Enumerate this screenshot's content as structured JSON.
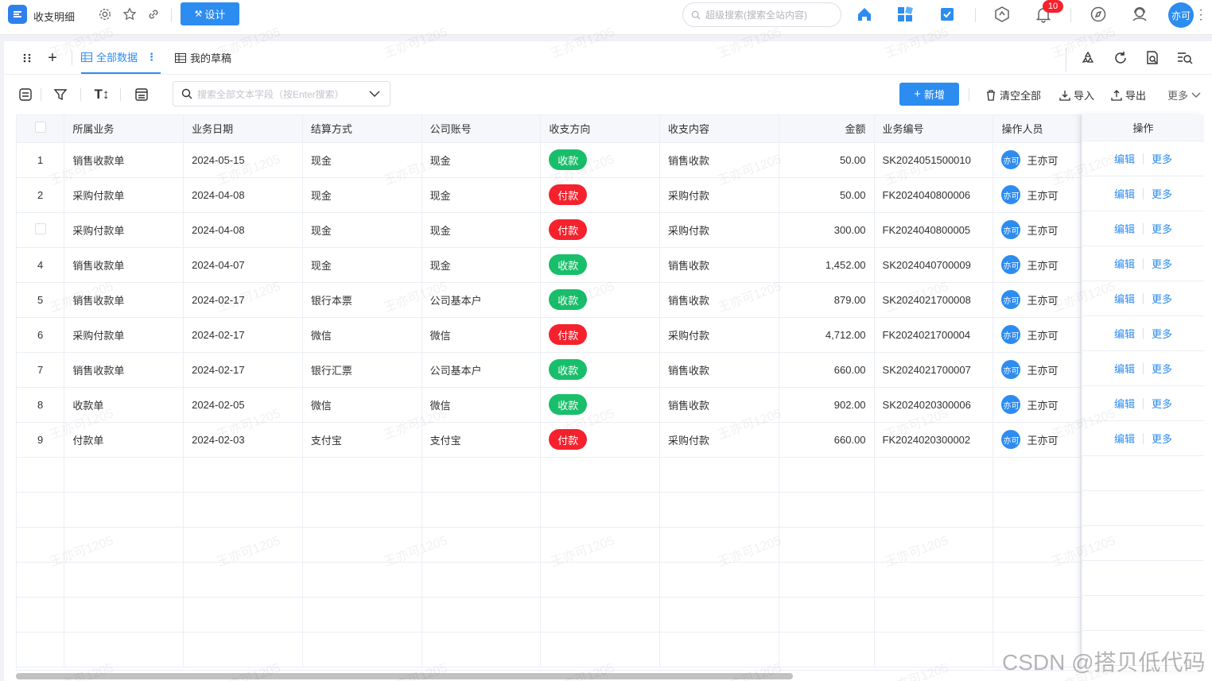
{
  "app": {
    "title": "收支明细",
    "design_label": "设计",
    "search_placeholder": "超级搜索(搜索全站内容)",
    "notification_count": "10",
    "user_avatar": "亦可"
  },
  "tabs": [
    {
      "label": "全部数据"
    },
    {
      "label": "我的草稿"
    }
  ],
  "toolbar": {
    "search_placeholder": "搜索全部文本字段（按Enter搜索）",
    "add_label": "新增",
    "clear_label": "清空全部",
    "import_label": "导入",
    "export_label": "导出",
    "more_label": "更多"
  },
  "table": {
    "columns": [
      "所属业务",
      "业务日期",
      "结算方式",
      "公司账号",
      "收支方向",
      "收支内容",
      "金额",
      "业务编号",
      "操作人员"
    ],
    "action_header": "操作",
    "rows": [
      {
        "idx": "1",
        "biz": "销售收款单",
        "date": "2024-05-15",
        "settle": "现金",
        "account": "现金",
        "dir": "收款",
        "content": "销售收款",
        "amount": "50.00",
        "code": "SK2024051500010",
        "op_avatar": "亦可",
        "operator": "王亦可"
      },
      {
        "idx": "2",
        "biz": "采购付款单",
        "date": "2024-04-08",
        "settle": "现金",
        "account": "现金",
        "dir": "付款",
        "content": "采购付款",
        "amount": "50.00",
        "code": "FK2024040800006",
        "op_avatar": "亦可",
        "operator": "王亦可"
      },
      {
        "idx": "",
        "biz": "采购付款单",
        "date": "2024-04-08",
        "settle": "现金",
        "account": "现金",
        "dir": "付款",
        "content": "采购付款",
        "amount": "300.00",
        "code": "FK2024040800005",
        "op_avatar": "亦可",
        "operator": "王亦可"
      },
      {
        "idx": "4",
        "biz": "销售收款单",
        "date": "2024-04-07",
        "settle": "现金",
        "account": "现金",
        "dir": "收款",
        "content": "销售收款",
        "amount": "1,452.00",
        "code": "SK2024040700009",
        "op_avatar": "亦可",
        "operator": "王亦可"
      },
      {
        "idx": "5",
        "biz": "销售收款单",
        "date": "2024-02-17",
        "settle": "银行本票",
        "account": "公司基本户",
        "dir": "收款",
        "content": "销售收款",
        "amount": "879.00",
        "code": "SK2024021700008",
        "op_avatar": "亦可",
        "operator": "王亦可"
      },
      {
        "idx": "6",
        "biz": "采购付款单",
        "date": "2024-02-17",
        "settle": "微信",
        "account": "微信",
        "dir": "付款",
        "content": "采购付款",
        "amount": "4,712.00",
        "code": "FK2024021700004",
        "op_avatar": "亦可",
        "operator": "王亦可"
      },
      {
        "idx": "7",
        "biz": "销售收款单",
        "date": "2024-02-17",
        "settle": "银行汇票",
        "account": "公司基本户",
        "dir": "收款",
        "content": "销售收款",
        "amount": "660.00",
        "code": "SK2024021700007",
        "op_avatar": "亦可",
        "operator": "王亦可"
      },
      {
        "idx": "8",
        "biz": "收款单",
        "date": "2024-02-05",
        "settle": "微信",
        "account": "微信",
        "dir": "收款",
        "content": "销售收款",
        "amount": "902.00",
        "code": "SK2024020300006",
        "op_avatar": "亦可",
        "operator": "王亦可"
      },
      {
        "idx": "9",
        "biz": "付款单",
        "date": "2024-02-03",
        "settle": "支付宝",
        "account": "支付宝",
        "dir": "付款",
        "content": "采购付款",
        "amount": "660.00",
        "code": "FK2024020300002",
        "op_avatar": "亦可",
        "operator": "王亦可"
      }
    ],
    "actions": {
      "edit": "编辑",
      "more": "更多"
    }
  },
  "colors": {
    "primary": "#2d8cf0",
    "income": "#19be6b",
    "expense": "#f5222d"
  },
  "watermark": "王亦可1205",
  "footer_watermark": "CSDN @搭贝低代码"
}
